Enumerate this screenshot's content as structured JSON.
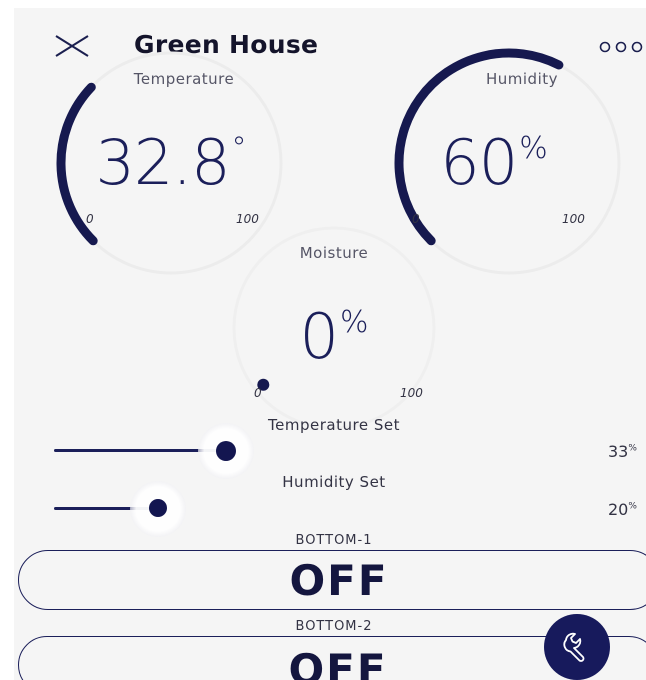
{
  "header": {
    "title": "Green House",
    "close_icon": "close-icon",
    "more_icon": "more-options-icon"
  },
  "gauges": {
    "temperature": {
      "label": "Temperature",
      "value": 32.8,
      "value_text": "32.8",
      "unit": "°",
      "min": "0",
      "max": "100"
    },
    "humidity": {
      "label": "Humidity",
      "value": 60,
      "value_text": "60",
      "unit": "%",
      "min": "0",
      "max": "100"
    },
    "moisture": {
      "label": "Moisture",
      "value": 0,
      "value_text": "0",
      "unit": "%",
      "min": "0",
      "max": "100"
    }
  },
  "sliders": {
    "temperature_set": {
      "label": "Temperature Set",
      "value": 33,
      "value_text": "33",
      "unit": "%"
    },
    "humidity_set": {
      "label": "Humidity Set",
      "value": 20,
      "value_text": "20",
      "unit": "%"
    }
  },
  "buttons": {
    "bottom1": {
      "label": "BOTTOM-1",
      "state": "OFF"
    },
    "bottom2": {
      "label": "BOTTOM-2",
      "state": "OFF"
    }
  },
  "fab": {
    "icon": "wrench-icon"
  },
  "colors": {
    "accent": "#1b1f5a",
    "background": "#f5f5f5",
    "fab": "#171a5c"
  }
}
